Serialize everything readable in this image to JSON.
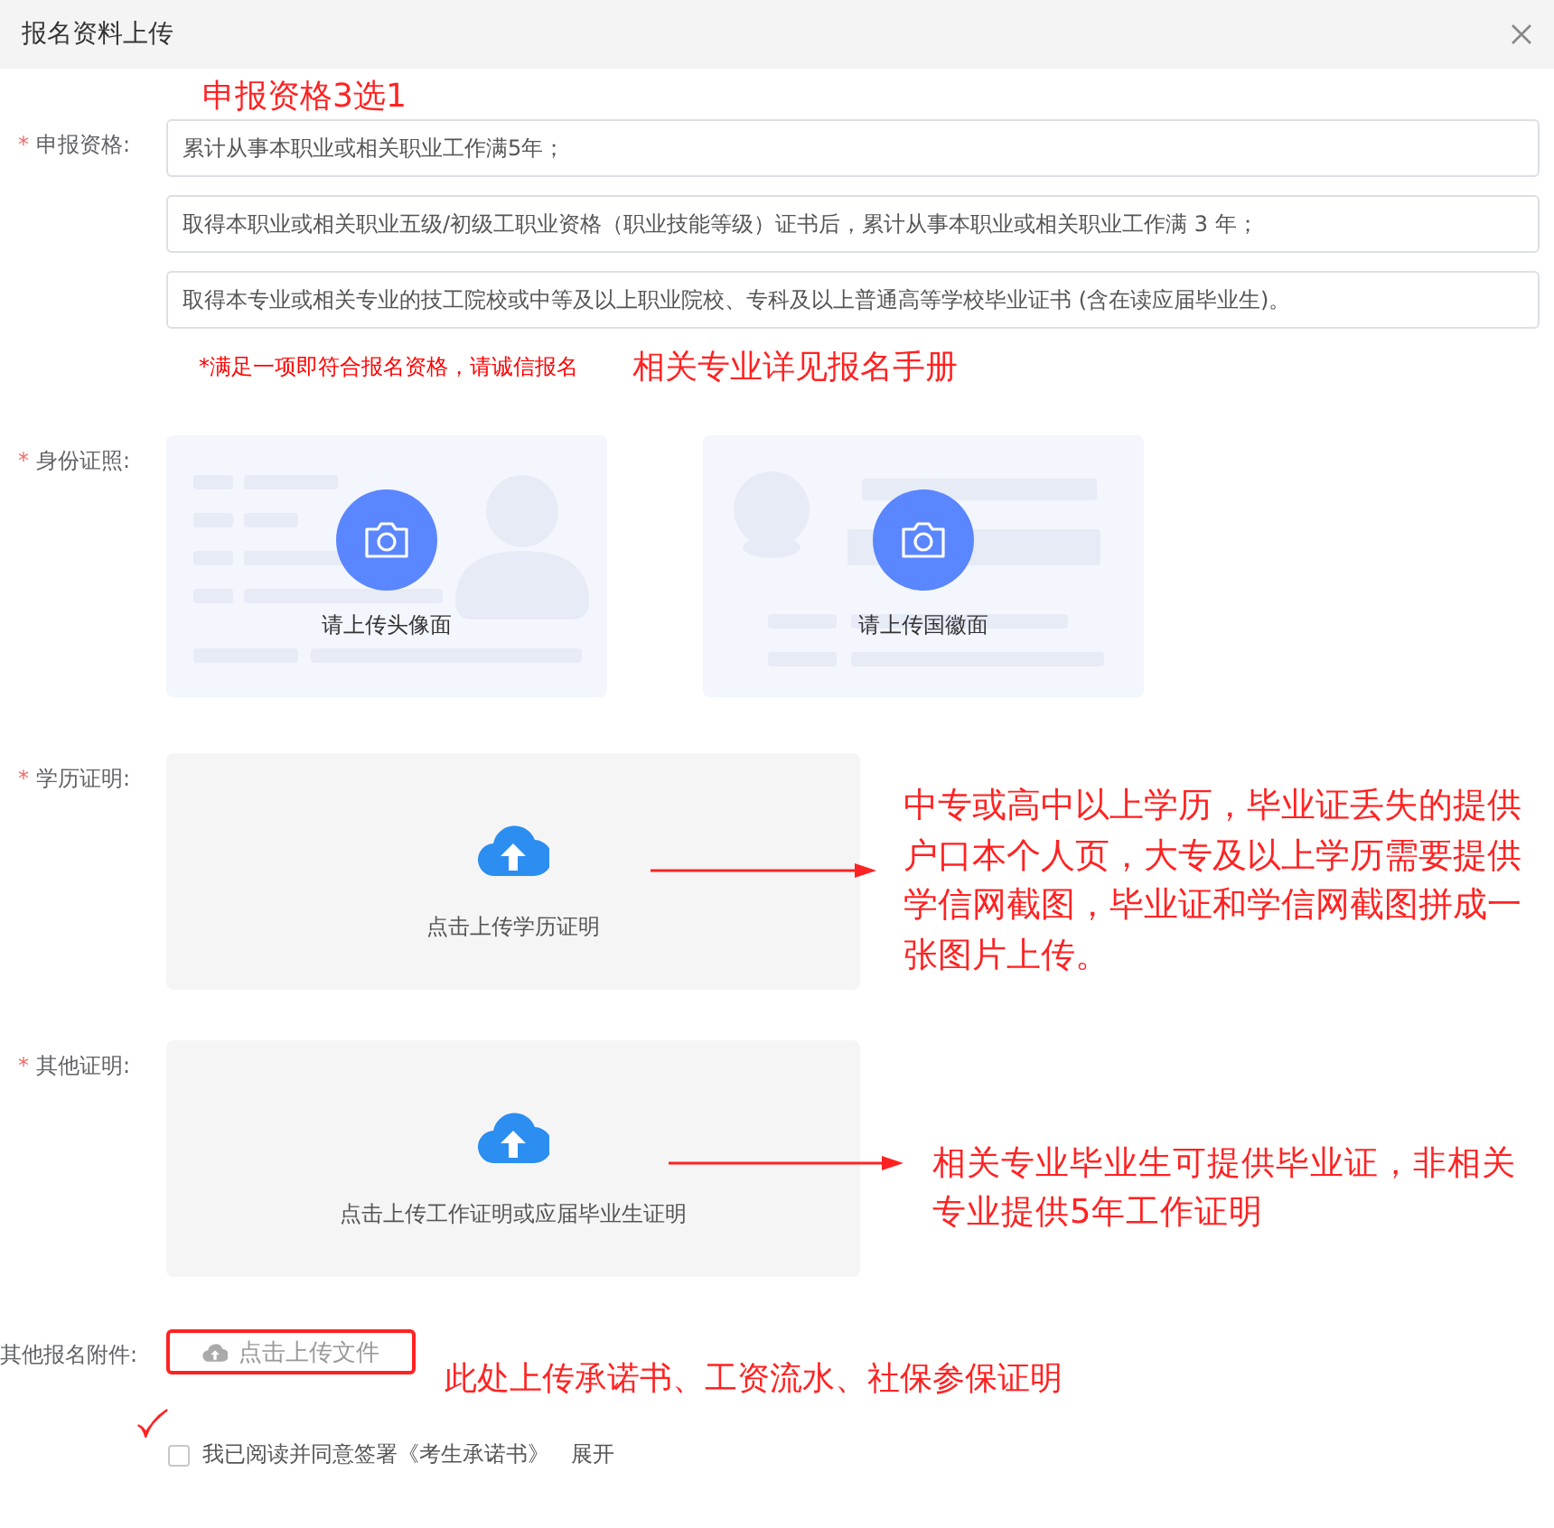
{
  "dialog_title": "报名资料上传",
  "qualification": {
    "marker": "*",
    "label": "申报资格:",
    "annotation": "申报资格3选1",
    "options": [
      "累计从事本职业或相关职业工作满5年；",
      "取得本职业或相关职业五级/初级工职业资格（职业技能等级）证书后，累计从事本职业或相关职业工作满 3 年；",
      "取得本专业或相关专业的技工院校或中等及以上职业院校、专科及以上普通高等学校毕业证书 (含在读应届毕业生)。"
    ],
    "note": "*满足一项即符合报名资格，请诚信报名",
    "note_annotation": "相关专业详见报名手册"
  },
  "id_photos": {
    "marker": "*",
    "label": "身份证照:",
    "cards": [
      {
        "kind": "front",
        "caption": "请上传头像面"
      },
      {
        "kind": "back",
        "caption": "请上传国徽面"
      }
    ]
  },
  "education": {
    "marker": "*",
    "label": "学历证明:",
    "upload_text": "点击上传学历证明",
    "annotation": "中专或高中以上学历，毕业证丢失的提供户口本个人页，大专及以上学历需要提供学信网截图，毕业证和学信网截图拼成一张图片上传。"
  },
  "other": {
    "marker": "*",
    "label": "其他证明:",
    "upload_text": "点击上传工作证明或应届毕业生证明",
    "annotation": "相关专业毕业生可提供毕业证，非相关专业提供5年工作证明"
  },
  "attachments": {
    "label": "其他报名附件:",
    "button": "点击上传文件",
    "annotation": "此处上传承诺书、工资流水、社保参保证明"
  },
  "agreement": {
    "checked": false,
    "text": "我已阅读并同意签署《考生承诺书》",
    "link": "展开"
  }
}
